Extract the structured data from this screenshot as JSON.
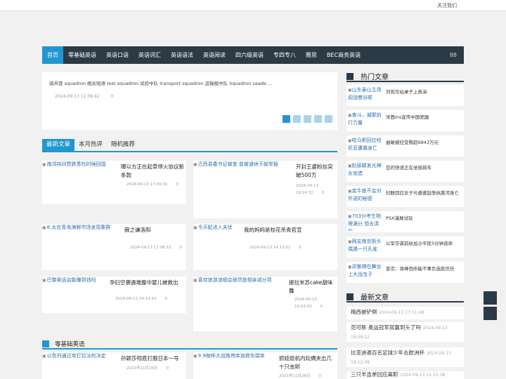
{
  "topbar": {
    "follow": "关注我们"
  },
  "nav": {
    "items": [
      "首页",
      "零基础英语",
      "英语口语",
      "英语词汇",
      "英语语法",
      "英语阅读",
      "四六级英语",
      "专四专八",
      "雅思",
      "BEC商务英语"
    ],
    "menu_icon": "88"
  },
  "ticker": {
    "text": "骑兵营    squadron 相关短语    test squadron 试验中队  transport squadron 运输舰中队  Squadron Leade ...",
    "date": "2024-09-13 12:09:42",
    "views": "0"
  },
  "tabs": [
    "最新文章",
    "本月热评",
    "随机推荐"
  ],
  "cards": [
    {
      "thumb": "南鸿祎间赞跌季险时候回国",
      "title": "曝以方正在起草停火协议新条款",
      "date": "2024-09-13 17:09:31",
      "views": "0"
    },
    {
      "thumb": "迁西县委书记被查 曾被谴休干部举报",
      "title": "开封王婆粉丝突破500万",
      "date": "2024-09-13 19:14:32",
      "views": "0"
    },
    {
      "thumb": "8.太在青岛海鲜市场发现集群",
      "title": "薛之谦洛阳",
      "date": "2024-09-13 17:06:32",
      "views": "0"
    },
    {
      "thumb": "今天起进入末伏",
      "title": "我的妈妈是校花杀青官宣",
      "date": "2024-09-13 14:13:52",
      "views": "0"
    },
    {
      "thumb": "巴黎奥运会能赚到钱吗",
      "title": "孕妇空袭遇难腹中婴儿被救出",
      "date": "2024-09-13 14:13:43",
      "views": "0"
    },
    {
      "thumb": "喜欢旅游滨咽会居然是相亲减分项",
      "title": "提拉米苏cake甜味舞",
      "date": "2024-09-13 19:03:02",
      "views": "0"
    }
  ],
  "section": {
    "title": "零基础英语"
  },
  "section_cards": [
    {
      "thumb": "以色列通过攻打拉法的决定",
      "title": "孙颖莎彻底打服日本一号",
      "date": "2021年11月26日",
      "views": "0"
    },
    {
      "thumb": "9.9咖啡大战拖垮库迪救伤瑞幸",
      "title": "抓娃娃机内玩偶夹出几十只虫卵",
      "date": "2021年11月26日",
      "views": "0"
    }
  ],
  "sidebar": {
    "hot_title": "热门文章",
    "hot": [
      {
        "thumb": "山东泰山主场迎战曼谷联",
        "title": "刘宪华站桌子上表演"
      },
      {
        "thumb": "奋斗，凝聚前行力量",
        "title": "宋茜ins宣传中国瓷器"
      },
      {
        "thumb": "哈马斯回应哈尼亚遭袭身亡",
        "title": "曲敏被控受贿超6843万元"
      },
      {
        "thumb": "赵丽颖发光神女妆造",
        "title": "您的快递正在坐摇摇车"
      },
      {
        "thumb": "金牛座不会对外说的秘密",
        "title": "妇联回应女子与婆婆起争执跳河身亡"
      },
      {
        "thumb": "703分考生物理满分 想去清华",
        "title": "PSX漫展试玩"
      },
      {
        "thumb": "网友南京街头偶遇一只孔雀",
        "title": "以军空袭前给加沙平民5分钟逃命"
      },
      {
        "thumb": "邓紫棋在舞台上大战虫子",
        "title": "普京：将峰恐所能不事负选民信任"
      }
    ],
    "latest_title": "最新文章",
    "latest": [
      {
        "title": "梅西被铲倒",
        "date": "2024-09-13 17:11:48"
      },
      {
        "title": "范可新 奥运冠军就赢到头了吗",
        "date": "2024-09-13 18:08:12"
      },
      {
        "title": "比亚迪邀百名足球少年去欧洲杯",
        "date": "2024-09-13 18:12:08"
      },
      {
        "title": "三只羊连单回应离职",
        "date": "2024-09-13 15:15:38"
      }
    ]
  }
}
